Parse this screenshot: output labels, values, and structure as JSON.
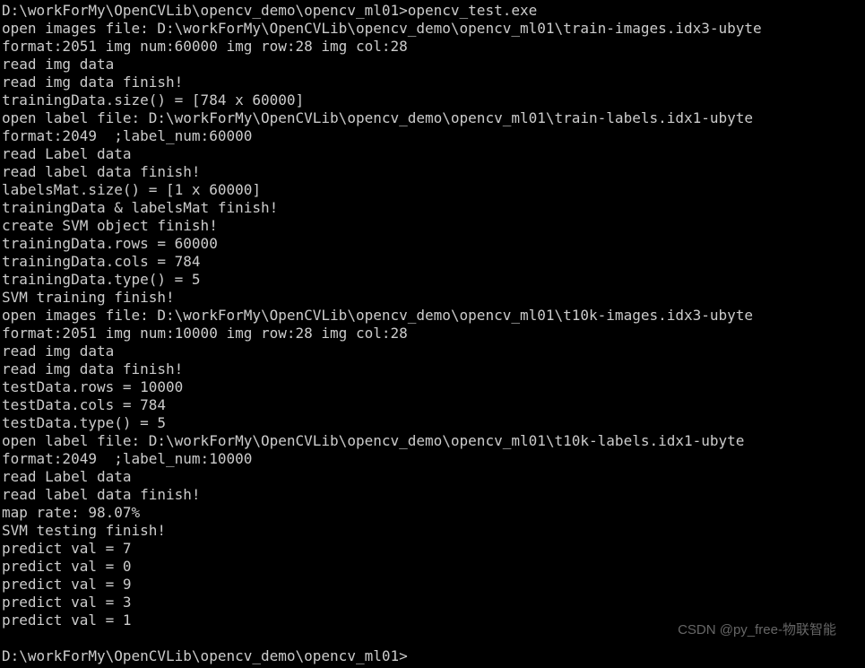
{
  "prompt1": "D:\\workForMy\\OpenCVLib\\opencv_demo\\opencv_ml01>opencv_test.exe",
  "lines": [
    "open images file: D:\\workForMy\\OpenCVLib\\opencv_demo\\opencv_ml01\\train-images.idx3-ubyte",
    "format:2051 img num:60000 img row:28 img col:28",
    "read img data",
    "read img data finish!",
    "trainingData.size() = [784 x 60000]",
    "open label file: D:\\workForMy\\OpenCVLib\\opencv_demo\\opencv_ml01\\train-labels.idx1-ubyte",
    "format:2049  ;label_num:60000",
    "read Label data",
    "read label data finish!",
    "labelsMat.size() = [1 x 60000]",
    "trainingData & labelsMat finish!",
    "create SVM object finish!",
    "trainingData.rows = 60000",
    "trainingData.cols = 784",
    "trainingData.type() = 5",
    "SVM training finish!",
    "open images file: D:\\workForMy\\OpenCVLib\\opencv_demo\\opencv_ml01\\t10k-images.idx3-ubyte",
    "format:2051 img num:10000 img row:28 img col:28",
    "read img data",
    "read img data finish!",
    "testData.rows = 10000",
    "testData.cols = 784",
    "testData.type() = 5",
    "open label file: D:\\workForMy\\OpenCVLib\\opencv_demo\\opencv_ml01\\t10k-labels.idx1-ubyte",
    "format:2049  ;label_num:10000",
    "read Label data",
    "read label data finish!",
    "map rate: 98.07%",
    "SVM testing finish!",
    "predict val = 7",
    "predict val = 0",
    "predict val = 9",
    "predict val = 3",
    "predict val = 1"
  ],
  "prompt2": "D:\\workForMy\\OpenCVLib\\opencv_demo\\opencv_ml01>",
  "watermark": "CSDN @py_free-物联智能"
}
